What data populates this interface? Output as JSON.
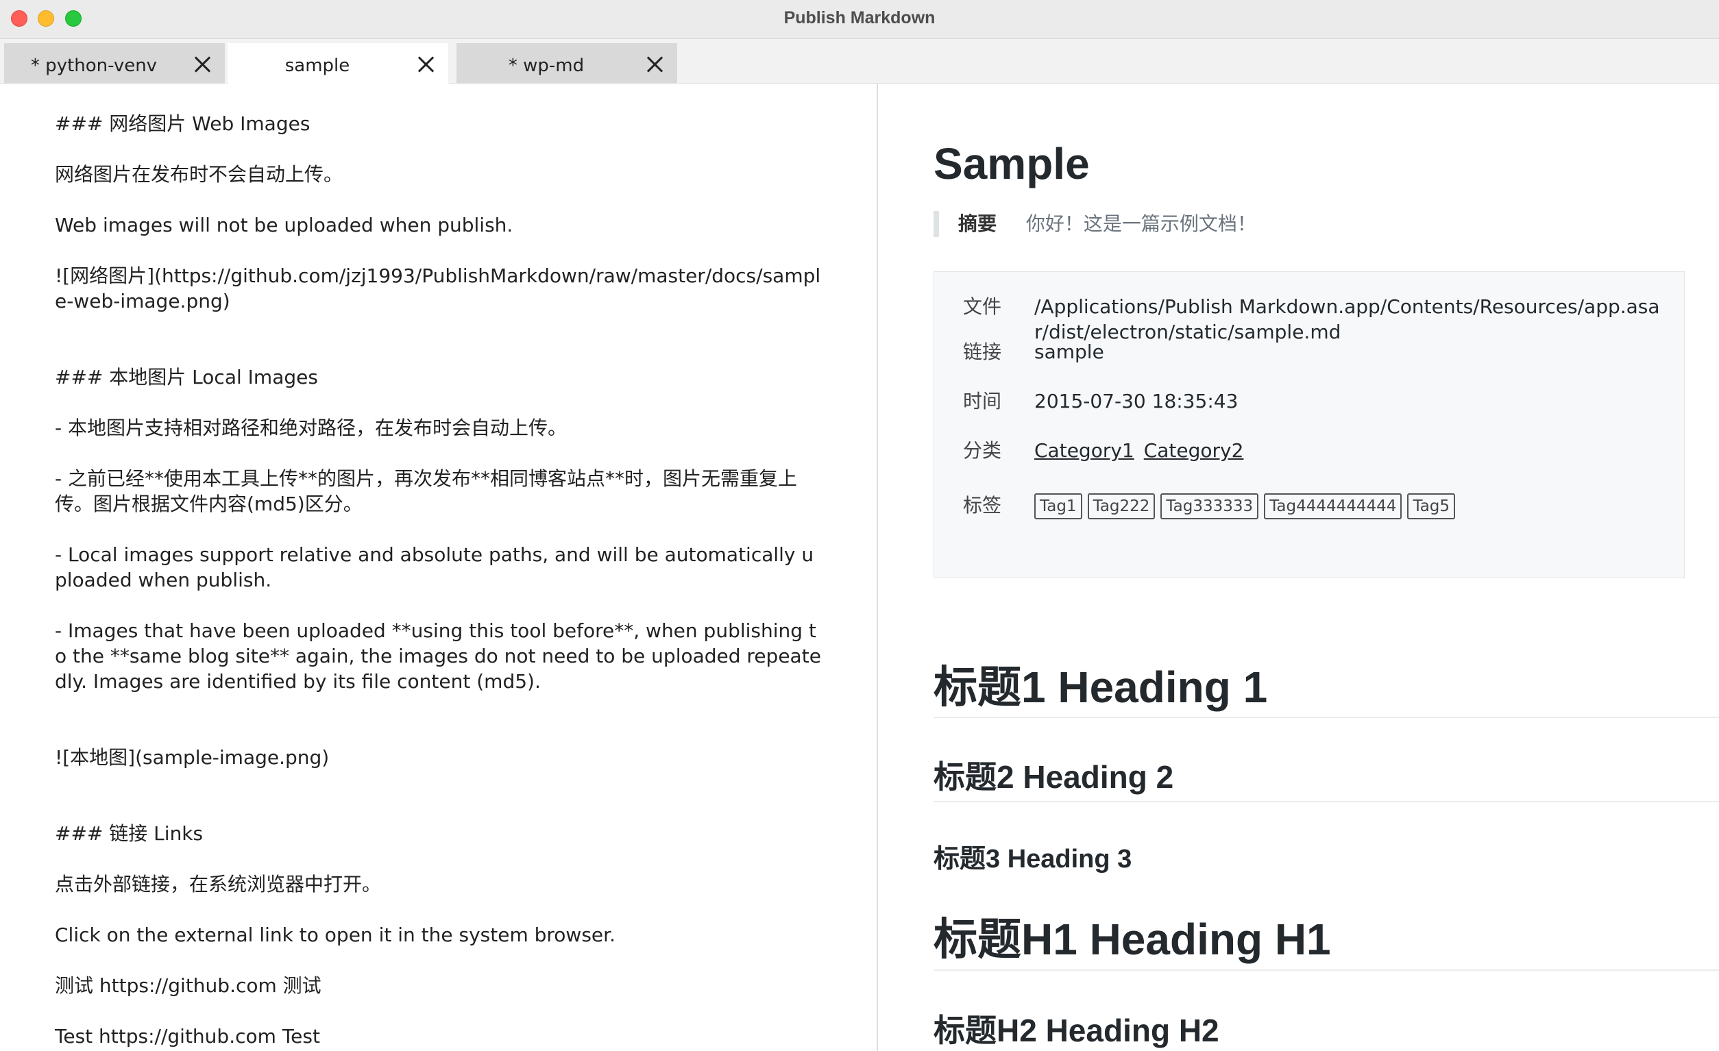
{
  "window": {
    "title": "Publish Markdown"
  },
  "tabs": [
    {
      "label": "* python-venv",
      "active": false
    },
    {
      "label": "sample",
      "active": true
    },
    {
      "label": "* wp-md",
      "active": false
    }
  ],
  "editor": {
    "lines": [
      "### 网络图片 Web Images",
      "",
      "网络图片在发布时不会自动上传。",
      "",
      "Web images will not be uploaded when publish.",
      "",
      "![网络图片](https://github.com/jzj1993/PublishMarkdown/raw/master/docs/sample-web-image.png)",
      "",
      "",
      "### 本地图片 Local Images",
      "",
      "- 本地图片支持相对路径和绝对路径，在发布时会自动上传。",
      "",
      "- 之前已经**使用本工具上传**的图片，再次发布**相同博客站点**时，图片无需重复上传。图片根据文件内容(md5)区分。",
      "",
      "- Local images support relative and absolute paths, and will be automatically uploaded when publish.",
      "",
      "- Images that have been uploaded **using this tool before**, when publishing to the **same blog site** again, the images do not need to be uploaded repeatedly. Images are identified by its file content (md5).",
      "",
      "",
      "![本地图](sample-image.png)",
      "",
      "",
      "### 链接 Links",
      "",
      "点击外部链接，在系统浏览器中打开。",
      "",
      "Click on the external link to open it in the system browser.",
      "",
      "测试 https://github.com 测试",
      "",
      "Test https://github.com Test"
    ]
  },
  "preview": {
    "title": "Sample",
    "summary_label": "摘要",
    "summary_text": "你好！这是一篇示例文档！",
    "meta": {
      "file_label": "文件",
      "file_value": "/Applications/Publish Markdown.app/Contents/Resources/app.asar/dist/electron/static/sample.md",
      "link_label": "链接",
      "link_value": "sample",
      "time_label": "时间",
      "time_value": "2015-07-30 18:35:43",
      "category_label": "分类",
      "categories": [
        "Category1",
        "Category2"
      ],
      "tags_label": "标签",
      "tags": [
        "Tag1",
        "Tag222",
        "Tag333333",
        "Tag4444444444",
        "Tag5"
      ]
    },
    "headings": [
      {
        "text": "标题1 Heading 1"
      },
      {
        "text": "标题2 Heading 2"
      },
      {
        "text": "标题3 Heading 3"
      },
      {
        "text": "标题H1 Heading H1"
      },
      {
        "text": "标题H2 Heading H2"
      }
    ]
  }
}
